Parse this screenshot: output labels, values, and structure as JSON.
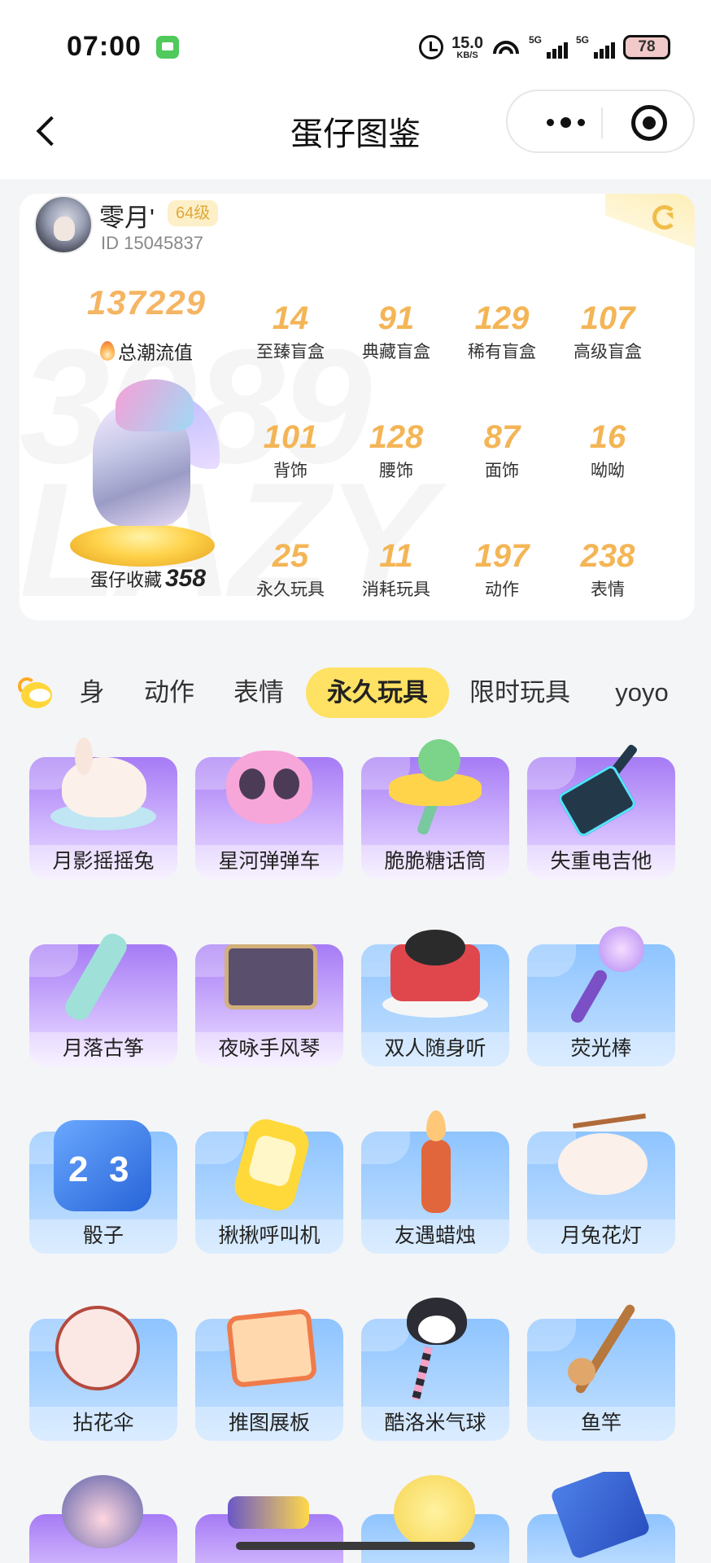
{
  "status_bar": {
    "time": "07:00",
    "net_speed_value": "15.0",
    "net_speed_unit": "KB/S",
    "signal_1_label": "5G",
    "signal_2_label": "5G",
    "battery": "78"
  },
  "header": {
    "title": "蛋仔图鉴"
  },
  "profile": {
    "username": "零月'",
    "level": "64级",
    "id_text": "ID 15045837",
    "trend_value": "137229",
    "trend_label": "总潮流值",
    "collection_label": "蛋仔收藏",
    "collection_value": "358",
    "watermark": "3089 LAZY"
  },
  "stats": [
    {
      "value": "14",
      "label": "至臻盲盒"
    },
    {
      "value": "91",
      "label": "典藏盲盒"
    },
    {
      "value": "129",
      "label": "稀有盲盒"
    },
    {
      "value": "107",
      "label": "高级盲盒"
    },
    {
      "value": "101",
      "label": "背饰"
    },
    {
      "value": "128",
      "label": "腰饰"
    },
    {
      "value": "87",
      "label": "面饰"
    },
    {
      "value": "16",
      "label": "呦呦"
    },
    {
      "value": "25",
      "label": "永久玩具"
    },
    {
      "value": "11",
      "label": "消耗玩具"
    },
    {
      "value": "197",
      "label": "动作"
    },
    {
      "value": "238",
      "label": "表情"
    }
  ],
  "tabs": [
    {
      "label": "身"
    },
    {
      "label": "动作"
    },
    {
      "label": "表情"
    },
    {
      "label": "永久玩具",
      "active": true
    },
    {
      "label": "限时玩具"
    },
    {
      "label": "yoyo"
    }
  ],
  "items": [
    {
      "name": "月影摇摇兔",
      "theme": "purple",
      "icon": "rabbit-icon"
    },
    {
      "name": "星河弹弹车",
      "theme": "purple",
      "icon": "car-icon"
    },
    {
      "name": "脆脆糖话筒",
      "theme": "purple",
      "icon": "microphone-icon"
    },
    {
      "name": "失重电吉他",
      "theme": "purple",
      "icon": "guitar-icon"
    },
    {
      "name": "月落古筝",
      "theme": "purple",
      "icon": "zheng-icon"
    },
    {
      "name": "夜咏手风琴",
      "theme": "purple",
      "icon": "accordion-icon"
    },
    {
      "name": "双人随身听",
      "theme": "blue",
      "icon": "record-player-icon"
    },
    {
      "name": "荧光棒",
      "theme": "blue",
      "icon": "glow-stick-icon"
    },
    {
      "name": "骰子",
      "theme": "blue",
      "icon": "dice-icon"
    },
    {
      "name": "揪揪呼叫机",
      "theme": "blue",
      "icon": "pager-icon"
    },
    {
      "name": "友遇蜡烛",
      "theme": "blue",
      "icon": "candle-icon"
    },
    {
      "name": "月兔花灯",
      "theme": "blue",
      "icon": "lantern-icon"
    },
    {
      "name": "拈花伞",
      "theme": "blue",
      "icon": "umbrella-icon"
    },
    {
      "name": "推图展板",
      "theme": "blue",
      "icon": "board-icon"
    },
    {
      "name": "酷洛米气球",
      "theme": "blue",
      "icon": "kuromi-balloon-icon"
    },
    {
      "name": "鱼竿",
      "theme": "blue",
      "icon": "fishing-rod-icon"
    }
  ],
  "dice_faces": [
    "2",
    "3"
  ],
  "colors": {
    "accent_yellow": "#ffe163",
    "stat_number": "#f4b556",
    "card_purple": "#a67bf5",
    "card_blue": "#8ec4ff"
  }
}
